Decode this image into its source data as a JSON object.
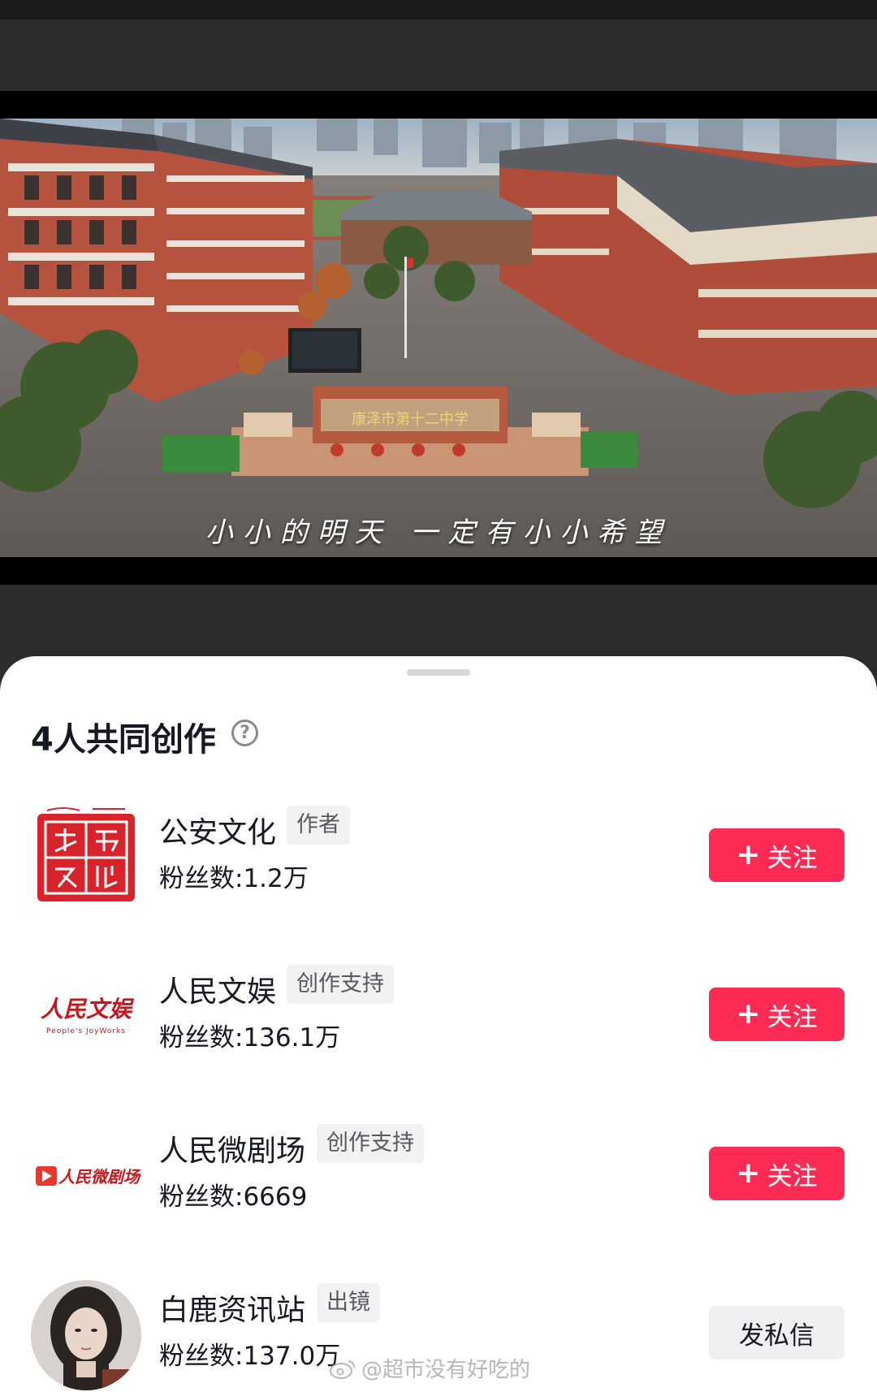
{
  "video": {
    "subtitle": "小小的明天 一定有小小希望",
    "school_gate_sign": "康泽市第十二中学"
  },
  "sheet": {
    "title": "4人共同创作",
    "help_icon": "question-circle-icon"
  },
  "creators": [
    {
      "name": "公安文化",
      "role": "作者",
      "fans": "粉丝数:1.2万",
      "action": "关注",
      "avatar_text": "公安文化",
      "avatar_color": "#d8232a"
    },
    {
      "name": "人民文娱",
      "role": "创作支持",
      "fans": "粉丝数:136.1万",
      "action": "关注",
      "avatar_text": "人民文娱",
      "avatar_subtext": "People's JoyWorks",
      "avatar_color": "#c8161d"
    },
    {
      "name": "人民微剧场",
      "role": "创作支持",
      "fans": "粉丝数:6669",
      "action": "关注",
      "avatar_text": "人民微剧场",
      "avatar_color": "#c8161d"
    },
    {
      "name": "白鹿资讯站",
      "role": "出镜",
      "fans": "粉丝数:137.0万",
      "action": "发私信",
      "avatar_color": "#3a3330"
    }
  ],
  "watermark": "@超市没有好吃的",
  "colors": {
    "follow_button": "#fe2c55",
    "sheet_background": "#ffffff",
    "backdrop": "#2e2b2b"
  }
}
